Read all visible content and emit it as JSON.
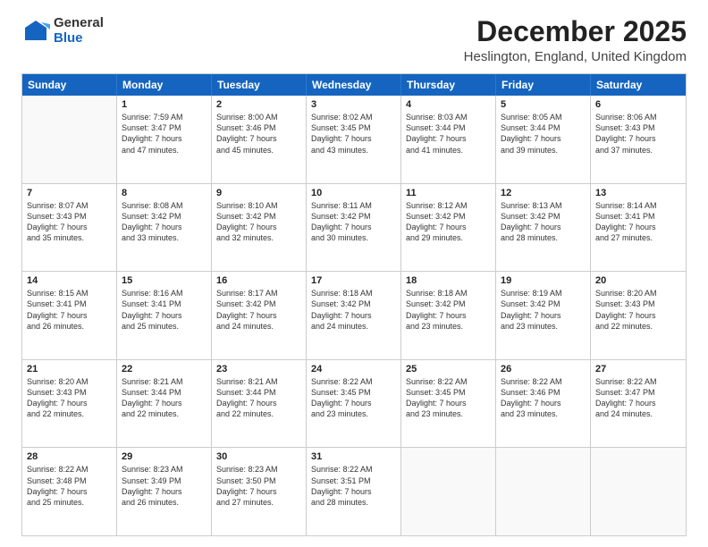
{
  "logo": {
    "general": "General",
    "blue": "Blue"
  },
  "title": "December 2025",
  "subtitle": "Heslington, England, United Kingdom",
  "header_days": [
    "Sunday",
    "Monday",
    "Tuesday",
    "Wednesday",
    "Thursday",
    "Friday",
    "Saturday"
  ],
  "rows": [
    [
      {
        "day": "",
        "empty": true
      },
      {
        "day": "1",
        "lines": [
          "Sunrise: 7:59 AM",
          "Sunset: 3:47 PM",
          "Daylight: 7 hours",
          "and 47 minutes."
        ]
      },
      {
        "day": "2",
        "lines": [
          "Sunrise: 8:00 AM",
          "Sunset: 3:46 PM",
          "Daylight: 7 hours",
          "and 45 minutes."
        ]
      },
      {
        "day": "3",
        "lines": [
          "Sunrise: 8:02 AM",
          "Sunset: 3:45 PM",
          "Daylight: 7 hours",
          "and 43 minutes."
        ]
      },
      {
        "day": "4",
        "lines": [
          "Sunrise: 8:03 AM",
          "Sunset: 3:44 PM",
          "Daylight: 7 hours",
          "and 41 minutes."
        ]
      },
      {
        "day": "5",
        "lines": [
          "Sunrise: 8:05 AM",
          "Sunset: 3:44 PM",
          "Daylight: 7 hours",
          "and 39 minutes."
        ]
      },
      {
        "day": "6",
        "lines": [
          "Sunrise: 8:06 AM",
          "Sunset: 3:43 PM",
          "Daylight: 7 hours",
          "and 37 minutes."
        ]
      }
    ],
    [
      {
        "day": "7",
        "lines": [
          "Sunrise: 8:07 AM",
          "Sunset: 3:43 PM",
          "Daylight: 7 hours",
          "and 35 minutes."
        ]
      },
      {
        "day": "8",
        "lines": [
          "Sunrise: 8:08 AM",
          "Sunset: 3:42 PM",
          "Daylight: 7 hours",
          "and 33 minutes."
        ]
      },
      {
        "day": "9",
        "lines": [
          "Sunrise: 8:10 AM",
          "Sunset: 3:42 PM",
          "Daylight: 7 hours",
          "and 32 minutes."
        ]
      },
      {
        "day": "10",
        "lines": [
          "Sunrise: 8:11 AM",
          "Sunset: 3:42 PM",
          "Daylight: 7 hours",
          "and 30 minutes."
        ]
      },
      {
        "day": "11",
        "lines": [
          "Sunrise: 8:12 AM",
          "Sunset: 3:42 PM",
          "Daylight: 7 hours",
          "and 29 minutes."
        ]
      },
      {
        "day": "12",
        "lines": [
          "Sunrise: 8:13 AM",
          "Sunset: 3:42 PM",
          "Daylight: 7 hours",
          "and 28 minutes."
        ]
      },
      {
        "day": "13",
        "lines": [
          "Sunrise: 8:14 AM",
          "Sunset: 3:41 PM",
          "Daylight: 7 hours",
          "and 27 minutes."
        ]
      }
    ],
    [
      {
        "day": "14",
        "lines": [
          "Sunrise: 8:15 AM",
          "Sunset: 3:41 PM",
          "Daylight: 7 hours",
          "and 26 minutes."
        ]
      },
      {
        "day": "15",
        "lines": [
          "Sunrise: 8:16 AM",
          "Sunset: 3:41 PM",
          "Daylight: 7 hours",
          "and 25 minutes."
        ]
      },
      {
        "day": "16",
        "lines": [
          "Sunrise: 8:17 AM",
          "Sunset: 3:42 PM",
          "Daylight: 7 hours",
          "and 24 minutes."
        ]
      },
      {
        "day": "17",
        "lines": [
          "Sunrise: 8:18 AM",
          "Sunset: 3:42 PM",
          "Daylight: 7 hours",
          "and 24 minutes."
        ]
      },
      {
        "day": "18",
        "lines": [
          "Sunrise: 8:18 AM",
          "Sunset: 3:42 PM",
          "Daylight: 7 hours",
          "and 23 minutes."
        ]
      },
      {
        "day": "19",
        "lines": [
          "Sunrise: 8:19 AM",
          "Sunset: 3:42 PM",
          "Daylight: 7 hours",
          "and 23 minutes."
        ]
      },
      {
        "day": "20",
        "lines": [
          "Sunrise: 8:20 AM",
          "Sunset: 3:43 PM",
          "Daylight: 7 hours",
          "and 22 minutes."
        ]
      }
    ],
    [
      {
        "day": "21",
        "lines": [
          "Sunrise: 8:20 AM",
          "Sunset: 3:43 PM",
          "Daylight: 7 hours",
          "and 22 minutes."
        ]
      },
      {
        "day": "22",
        "lines": [
          "Sunrise: 8:21 AM",
          "Sunset: 3:44 PM",
          "Daylight: 7 hours",
          "and 22 minutes."
        ]
      },
      {
        "day": "23",
        "lines": [
          "Sunrise: 8:21 AM",
          "Sunset: 3:44 PM",
          "Daylight: 7 hours",
          "and 22 minutes."
        ]
      },
      {
        "day": "24",
        "lines": [
          "Sunrise: 8:22 AM",
          "Sunset: 3:45 PM",
          "Daylight: 7 hours",
          "and 23 minutes."
        ]
      },
      {
        "day": "25",
        "lines": [
          "Sunrise: 8:22 AM",
          "Sunset: 3:45 PM",
          "Daylight: 7 hours",
          "and 23 minutes."
        ]
      },
      {
        "day": "26",
        "lines": [
          "Sunrise: 8:22 AM",
          "Sunset: 3:46 PM",
          "Daylight: 7 hours",
          "and 23 minutes."
        ]
      },
      {
        "day": "27",
        "lines": [
          "Sunrise: 8:22 AM",
          "Sunset: 3:47 PM",
          "Daylight: 7 hours",
          "and 24 minutes."
        ]
      }
    ],
    [
      {
        "day": "28",
        "lines": [
          "Sunrise: 8:22 AM",
          "Sunset: 3:48 PM",
          "Daylight: 7 hours",
          "and 25 minutes."
        ]
      },
      {
        "day": "29",
        "lines": [
          "Sunrise: 8:23 AM",
          "Sunset: 3:49 PM",
          "Daylight: 7 hours",
          "and 26 minutes."
        ]
      },
      {
        "day": "30",
        "lines": [
          "Sunrise: 8:23 AM",
          "Sunset: 3:50 PM",
          "Daylight: 7 hours",
          "and 27 minutes."
        ]
      },
      {
        "day": "31",
        "lines": [
          "Sunrise: 8:22 AM",
          "Sunset: 3:51 PM",
          "Daylight: 7 hours",
          "and 28 minutes."
        ]
      },
      {
        "day": "",
        "empty": true
      },
      {
        "day": "",
        "empty": true
      },
      {
        "day": "",
        "empty": true
      }
    ]
  ]
}
